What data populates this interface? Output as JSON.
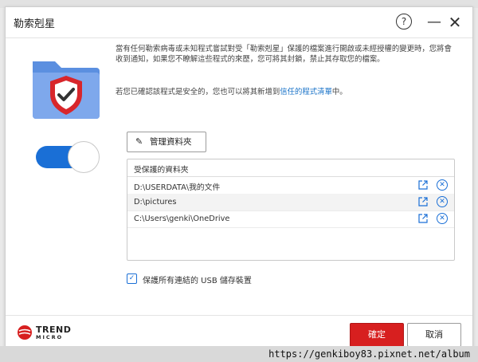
{
  "window": {
    "title": "勒索剋星",
    "help_symbol": "?",
    "minimize_symbol": "—",
    "close_symbol": "✕"
  },
  "description": {
    "line1": "當有任何勒索病毒或未知程式嘗試對受「勒索剋星」保護的檔案進行開啟或未經授權的變更時，您將會收到通知，如果您不瞭解這些程式的來歷，您可將其封鎖，禁止其存取您的檔案。",
    "line2_prefix": "若您已確認該程式是安全的，您也可以將其新增到",
    "line2_link": "信任的程式清單",
    "line2_suffix": "中。"
  },
  "toggle": {
    "state": "on",
    "accent": "#1a6fd6"
  },
  "manage_button": {
    "label": "管理資料夾",
    "icon": "pencil-icon"
  },
  "folders": {
    "header": "受保護的資料夾",
    "items": [
      {
        "path": "D:\\USERDATA\\我的文件"
      },
      {
        "path": "D:\\pictures"
      },
      {
        "path": "C:\\Users\\genki\\OneDrive"
      }
    ]
  },
  "usb": {
    "label": "保護所有連結的 USB 儲存裝置",
    "checked": true,
    "check_symbol": "✓"
  },
  "footer": {
    "brand_line1": "TREND",
    "brand_line2": "MICRO",
    "ok_label": "確定",
    "cancel_label": "取消",
    "ok_color": "#d71f1f"
  },
  "watermark": "https://genkiboy83.pixnet.net/album"
}
